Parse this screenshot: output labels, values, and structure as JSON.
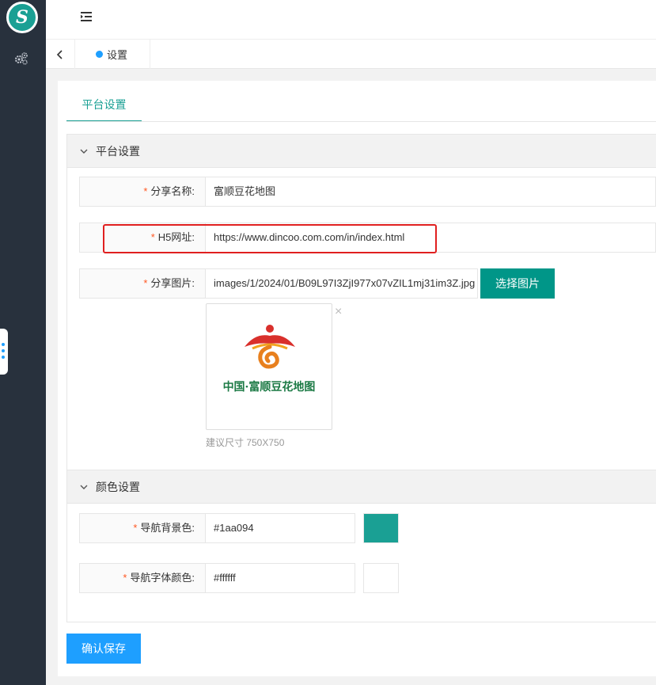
{
  "app": {
    "logo_letter": "S"
  },
  "sidebar": {
    "icons": [
      "settings-gears-icon"
    ]
  },
  "header": {
    "menu_icon": "menu-toggle-icon"
  },
  "tabs": {
    "items": [
      {
        "label": "设置",
        "active": true
      }
    ]
  },
  "page": {
    "tab_label": "平台设置",
    "accent_color": "#1aa094"
  },
  "platform_section": {
    "title": "平台设置",
    "share_name": {
      "label": "分享名称:",
      "value": "富顺豆花地图"
    },
    "h5_url": {
      "label": "H5网址:",
      "value": "https://www.dincoo.com.com/in/index.html"
    },
    "share_image": {
      "label": "分享图片:",
      "value": "images/1/2024/01/B09L97I3ZjI977x07vZIL1mj31im3Z.jpg",
      "choose_button": "选择图片",
      "preview_caption": "中国·富顺豆花地图",
      "remove_symbol": "×",
      "size_hint": "建议尺寸 750X750"
    }
  },
  "color_section": {
    "title": "颜色设置",
    "nav_bg": {
      "label": "导航背景色:",
      "value": "#1aa094",
      "swatch": "#1aa094"
    },
    "nav_font": {
      "label": "导航字体颜色:",
      "value": "#ffffff",
      "swatch": "#ffffff"
    }
  },
  "actions": {
    "save_button": "确认保存"
  },
  "required_mark": "*"
}
